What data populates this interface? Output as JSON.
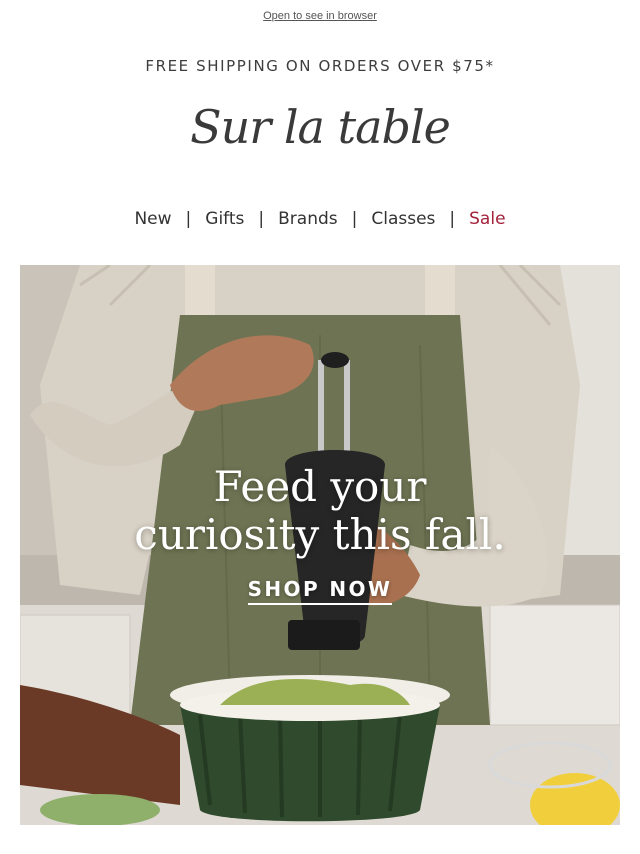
{
  "header": {
    "browser_link": "Open to see in browser",
    "shipping": "FREE SHIPPING ON ORDERS OVER $75*",
    "logo": "Sur la table"
  },
  "nav": {
    "items": [
      {
        "label": "New"
      },
      {
        "label": "Gifts"
      },
      {
        "label": "Brands"
      },
      {
        "label": "Classes"
      },
      {
        "label": "Sale"
      }
    ],
    "separator": "|"
  },
  "hero": {
    "headline_line1": "Feed your",
    "headline_line2": "curiosity this fall.",
    "cta": "SHOP NOW",
    "image_description": "pepper-grinder-over-salad-bowl-photo"
  },
  "colors": {
    "sale": "#a3213a",
    "text": "#333333",
    "apron": "#6e7453",
    "bowl": "#2f4a2c"
  }
}
